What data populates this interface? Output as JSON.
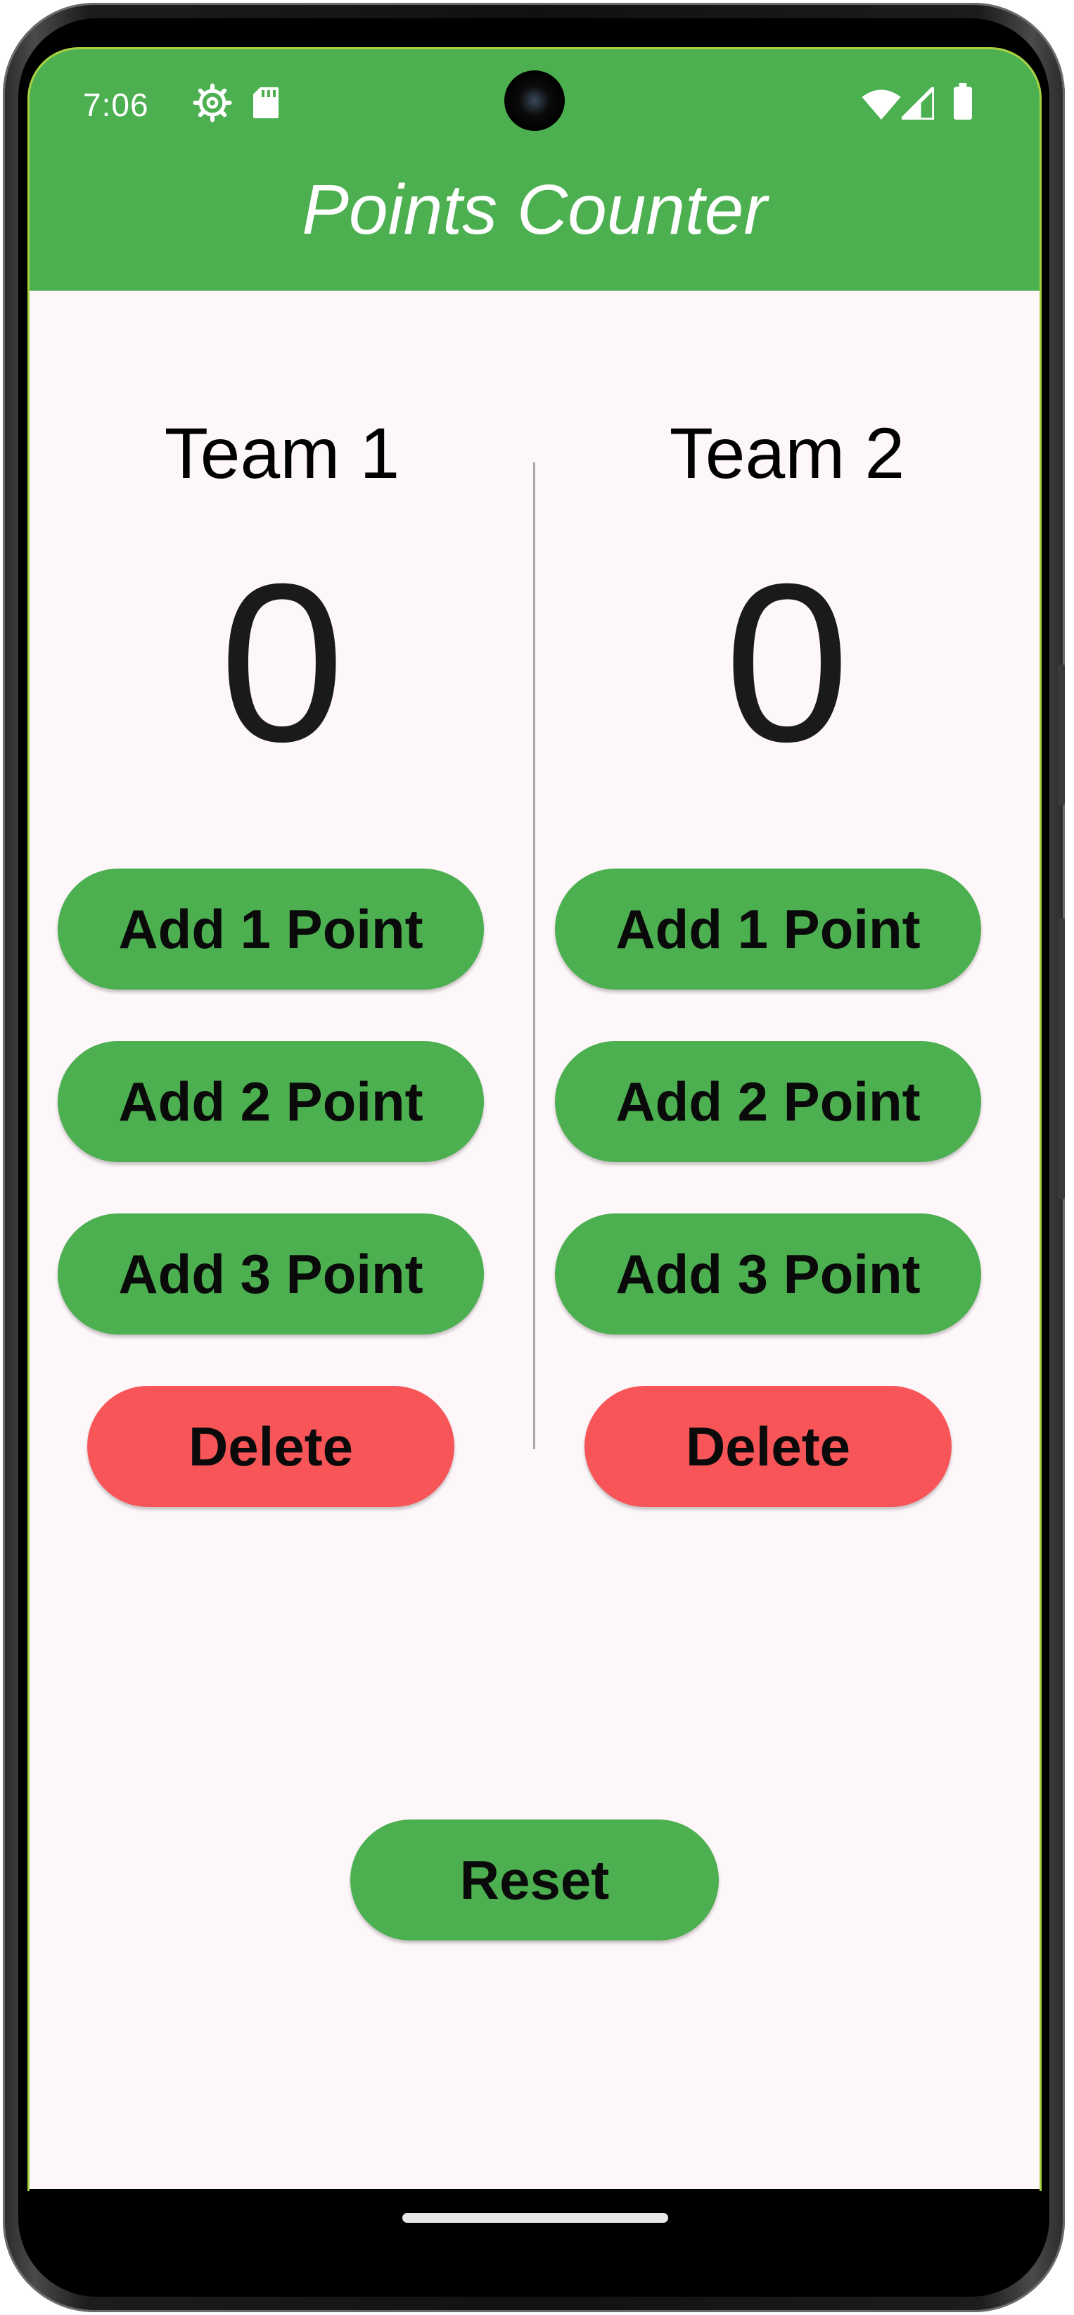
{
  "status_bar": {
    "time": "7:06"
  },
  "app": {
    "title": "Points Counter",
    "primary_color": "#4caf50",
    "delete_color": "#f75558"
  },
  "teams": [
    {
      "name": "Team 1",
      "score": "0",
      "buttons": {
        "add1": "Add 1 Point",
        "add2": "Add 2 Point",
        "add3": "Add 3 Point",
        "delete": "Delete"
      }
    },
    {
      "name": "Team 2",
      "score": "0",
      "buttons": {
        "add1": "Add 1 Point",
        "add2": "Add 2 Point",
        "add3": "Add 3 Point",
        "delete": "Delete"
      }
    }
  ],
  "reset_label": "Reset"
}
